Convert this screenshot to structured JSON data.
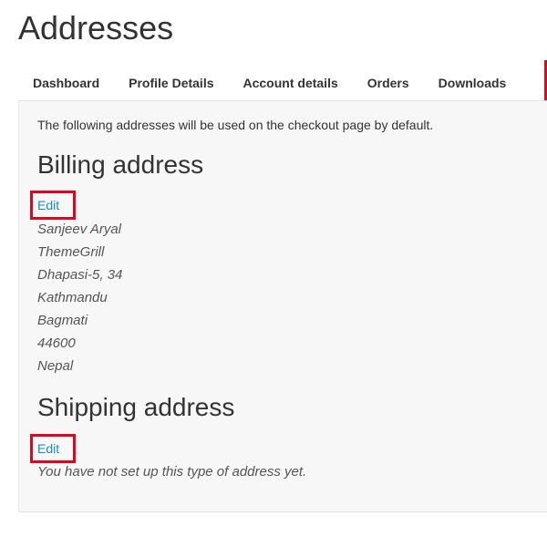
{
  "page": {
    "title": "Addresses"
  },
  "tabs": [
    {
      "label": "Dashboard"
    },
    {
      "label": "Profile Details"
    },
    {
      "label": "Account details"
    },
    {
      "label": "Orders"
    },
    {
      "label": "Downloads"
    }
  ],
  "content": {
    "intro": "The following addresses will be used on the checkout page by default.",
    "billing": {
      "title": "Billing address",
      "edit_label": "Edit",
      "lines": [
        "Sanjeev Aryal",
        "ThemeGrill",
        "Dhapasi-5, 34",
        "Kathmandu",
        "Bagmati",
        "44600",
        "Nepal"
      ]
    },
    "shipping": {
      "title": "Shipping address",
      "edit_label": "Edit",
      "empty_text": "You have not set up this type of address yet."
    }
  },
  "colors": {
    "accent_red": "#e1051e",
    "link_blue": "#1e8cbe"
  }
}
